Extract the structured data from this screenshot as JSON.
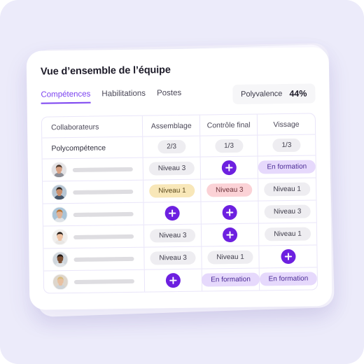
{
  "card": {
    "title": "Vue d’ensemble de l’équipe",
    "tabs": [
      {
        "label": "Compétences",
        "active": true
      },
      {
        "label": "Habilitations",
        "active": false
      },
      {
        "label": "Postes",
        "active": false
      }
    ],
    "polyvalence": {
      "label": "Polyvalence",
      "value": "44%"
    }
  },
  "table": {
    "columns": [
      "Collaborateurs",
      "Assemblage",
      "Contrôle final",
      "Vissage"
    ],
    "summary_row": {
      "label": "Polycompétence",
      "values": [
        "2/3",
        "1/3",
        "1/3"
      ]
    },
    "rows": [
      {
        "avatar": "avatar-person-1",
        "name_placeholder": "",
        "cells": [
          {
            "type": "pill",
            "style": "gray",
            "label": "Niveau 3"
          },
          {
            "type": "add",
            "style": "purple",
            "label": "+"
          },
          {
            "type": "pill",
            "style": "purple",
            "label": "En formation"
          }
        ]
      },
      {
        "avatar": "avatar-person-2",
        "name_placeholder": "",
        "cells": [
          {
            "type": "pill",
            "style": "yellow",
            "label": "Niveau 1"
          },
          {
            "type": "pill",
            "style": "pink",
            "label": "Niveau 3"
          },
          {
            "type": "pill",
            "style": "gray",
            "label": "Niveau 1"
          }
        ]
      },
      {
        "avatar": "avatar-person-3",
        "name_placeholder": "",
        "cells": [
          {
            "type": "add",
            "style": "purple",
            "label": "+"
          },
          {
            "type": "add",
            "style": "purple",
            "label": "+"
          },
          {
            "type": "pill",
            "style": "gray",
            "label": "Niveau 3"
          }
        ]
      },
      {
        "avatar": "avatar-person-4",
        "name_placeholder": "",
        "cells": [
          {
            "type": "pill",
            "style": "gray",
            "label": "Niveau 3"
          },
          {
            "type": "add",
            "style": "purple",
            "label": "+"
          },
          {
            "type": "pill",
            "style": "gray",
            "label": "Niveau 1"
          }
        ]
      },
      {
        "avatar": "avatar-person-5",
        "name_placeholder": "",
        "cells": [
          {
            "type": "pill",
            "style": "gray",
            "label": "Niveau 3"
          },
          {
            "type": "pill",
            "style": "gray",
            "label": "Niveau 1"
          },
          {
            "type": "add",
            "style": "purple",
            "label": "+"
          }
        ]
      },
      {
        "avatar": "avatar-person-6",
        "name_placeholder": "",
        "cells": [
          {
            "type": "add",
            "style": "purple",
            "label": "+"
          },
          {
            "type": "pill",
            "style": "purple",
            "label": "En formation"
          },
          {
            "type": "pill",
            "style": "purple",
            "label": "En formation"
          }
        ]
      }
    ]
  },
  "colors": {
    "background": "#ecebfa",
    "accent": "#7b42f0",
    "add_button": "#6d20e0",
    "pill_gray": "#eeedf1",
    "pill_yellow": "#f8e7b8",
    "pill_pink": "#fbd2d6",
    "pill_purple": "#e6d9fc",
    "grid_line": "#e9e5f9"
  }
}
